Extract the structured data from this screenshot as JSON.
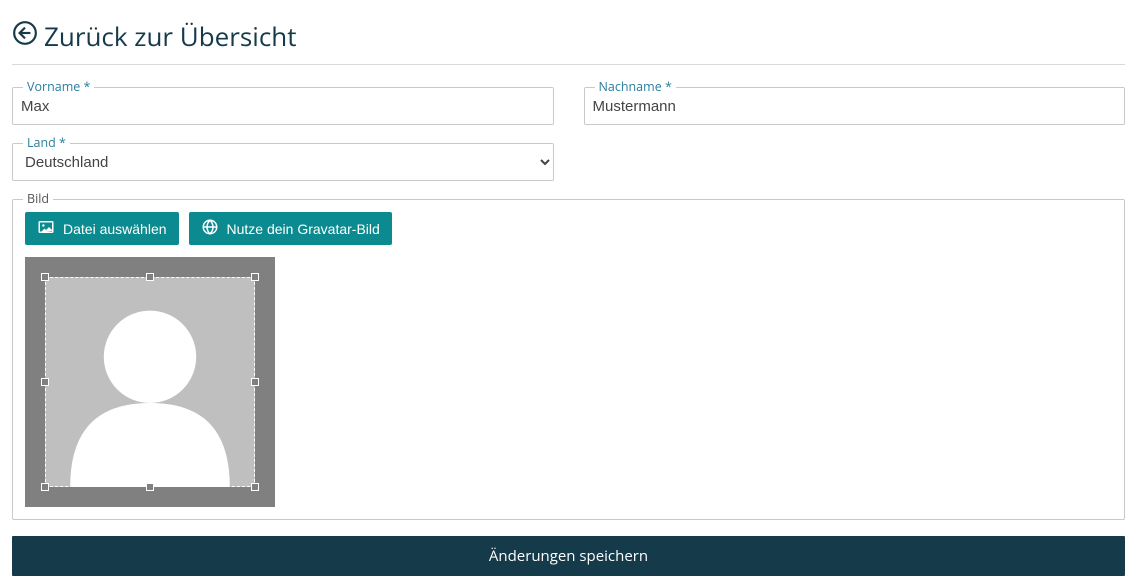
{
  "header": {
    "back_label": "Zurück zur Übersicht"
  },
  "form": {
    "firstname_label": "Vorname *",
    "firstname_value": "Max",
    "lastname_label": "Nachname *",
    "lastname_value": "Mustermann",
    "country_label": "Land *",
    "country_value": "Deutschland",
    "image_label": "Bild",
    "choose_file_label": "Datei auswählen",
    "use_gravatar_label": "Nutze dein Gravatar-Bild"
  },
  "actions": {
    "save_label": "Änderungen speichern"
  }
}
